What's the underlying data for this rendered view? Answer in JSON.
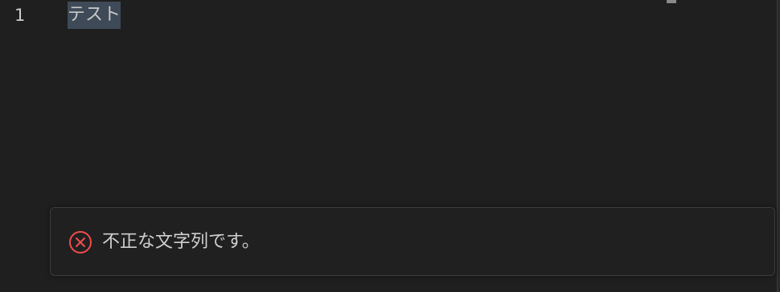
{
  "editor": {
    "line_number": "1",
    "line_text": "テスト"
  },
  "notification": {
    "icon": "error-circle-x-icon",
    "message": "不正な文字列です。",
    "accent_color": "#f14c4c"
  }
}
